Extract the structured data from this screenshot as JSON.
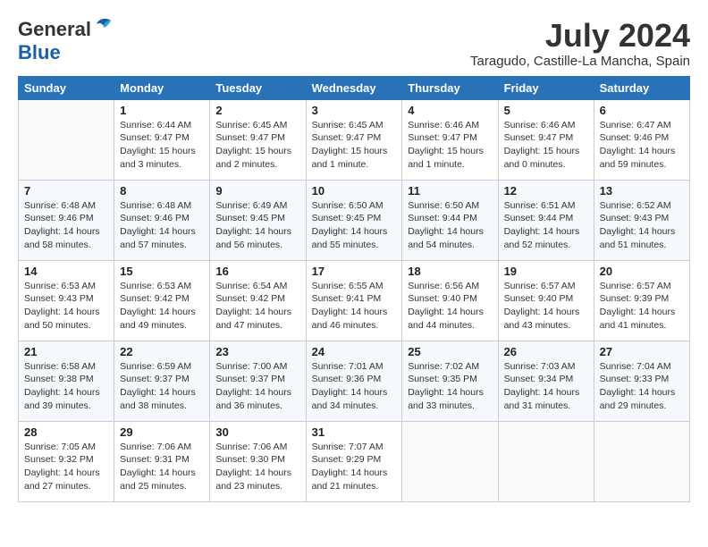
{
  "header": {
    "logo_general": "General",
    "logo_blue": "Blue",
    "month_year": "July 2024",
    "location": "Taragudo, Castille-La Mancha, Spain"
  },
  "weekdays": [
    "Sunday",
    "Monday",
    "Tuesday",
    "Wednesday",
    "Thursday",
    "Friday",
    "Saturday"
  ],
  "weeks": [
    [
      {
        "day": "",
        "info": ""
      },
      {
        "day": "1",
        "info": "Sunrise: 6:44 AM\nSunset: 9:47 PM\nDaylight: 15 hours\nand 3 minutes."
      },
      {
        "day": "2",
        "info": "Sunrise: 6:45 AM\nSunset: 9:47 PM\nDaylight: 15 hours\nand 2 minutes."
      },
      {
        "day": "3",
        "info": "Sunrise: 6:45 AM\nSunset: 9:47 PM\nDaylight: 15 hours\nand 1 minute."
      },
      {
        "day": "4",
        "info": "Sunrise: 6:46 AM\nSunset: 9:47 PM\nDaylight: 15 hours\nand 1 minute."
      },
      {
        "day": "5",
        "info": "Sunrise: 6:46 AM\nSunset: 9:47 PM\nDaylight: 15 hours\nand 0 minutes."
      },
      {
        "day": "6",
        "info": "Sunrise: 6:47 AM\nSunset: 9:46 PM\nDaylight: 14 hours\nand 59 minutes."
      }
    ],
    [
      {
        "day": "7",
        "info": "Sunrise: 6:48 AM\nSunset: 9:46 PM\nDaylight: 14 hours\nand 58 minutes."
      },
      {
        "day": "8",
        "info": "Sunrise: 6:48 AM\nSunset: 9:46 PM\nDaylight: 14 hours\nand 57 minutes."
      },
      {
        "day": "9",
        "info": "Sunrise: 6:49 AM\nSunset: 9:45 PM\nDaylight: 14 hours\nand 56 minutes."
      },
      {
        "day": "10",
        "info": "Sunrise: 6:50 AM\nSunset: 9:45 PM\nDaylight: 14 hours\nand 55 minutes."
      },
      {
        "day": "11",
        "info": "Sunrise: 6:50 AM\nSunset: 9:44 PM\nDaylight: 14 hours\nand 54 minutes."
      },
      {
        "day": "12",
        "info": "Sunrise: 6:51 AM\nSunset: 9:44 PM\nDaylight: 14 hours\nand 52 minutes."
      },
      {
        "day": "13",
        "info": "Sunrise: 6:52 AM\nSunset: 9:43 PM\nDaylight: 14 hours\nand 51 minutes."
      }
    ],
    [
      {
        "day": "14",
        "info": "Sunrise: 6:53 AM\nSunset: 9:43 PM\nDaylight: 14 hours\nand 50 minutes."
      },
      {
        "day": "15",
        "info": "Sunrise: 6:53 AM\nSunset: 9:42 PM\nDaylight: 14 hours\nand 49 minutes."
      },
      {
        "day": "16",
        "info": "Sunrise: 6:54 AM\nSunset: 9:42 PM\nDaylight: 14 hours\nand 47 minutes."
      },
      {
        "day": "17",
        "info": "Sunrise: 6:55 AM\nSunset: 9:41 PM\nDaylight: 14 hours\nand 46 minutes."
      },
      {
        "day": "18",
        "info": "Sunrise: 6:56 AM\nSunset: 9:40 PM\nDaylight: 14 hours\nand 44 minutes."
      },
      {
        "day": "19",
        "info": "Sunrise: 6:57 AM\nSunset: 9:40 PM\nDaylight: 14 hours\nand 43 minutes."
      },
      {
        "day": "20",
        "info": "Sunrise: 6:57 AM\nSunset: 9:39 PM\nDaylight: 14 hours\nand 41 minutes."
      }
    ],
    [
      {
        "day": "21",
        "info": "Sunrise: 6:58 AM\nSunset: 9:38 PM\nDaylight: 14 hours\nand 39 minutes."
      },
      {
        "day": "22",
        "info": "Sunrise: 6:59 AM\nSunset: 9:37 PM\nDaylight: 14 hours\nand 38 minutes."
      },
      {
        "day": "23",
        "info": "Sunrise: 7:00 AM\nSunset: 9:37 PM\nDaylight: 14 hours\nand 36 minutes."
      },
      {
        "day": "24",
        "info": "Sunrise: 7:01 AM\nSunset: 9:36 PM\nDaylight: 14 hours\nand 34 minutes."
      },
      {
        "day": "25",
        "info": "Sunrise: 7:02 AM\nSunset: 9:35 PM\nDaylight: 14 hours\nand 33 minutes."
      },
      {
        "day": "26",
        "info": "Sunrise: 7:03 AM\nSunset: 9:34 PM\nDaylight: 14 hours\nand 31 minutes."
      },
      {
        "day": "27",
        "info": "Sunrise: 7:04 AM\nSunset: 9:33 PM\nDaylight: 14 hours\nand 29 minutes."
      }
    ],
    [
      {
        "day": "28",
        "info": "Sunrise: 7:05 AM\nSunset: 9:32 PM\nDaylight: 14 hours\nand 27 minutes."
      },
      {
        "day": "29",
        "info": "Sunrise: 7:06 AM\nSunset: 9:31 PM\nDaylight: 14 hours\nand 25 minutes."
      },
      {
        "day": "30",
        "info": "Sunrise: 7:06 AM\nSunset: 9:30 PM\nDaylight: 14 hours\nand 23 minutes."
      },
      {
        "day": "31",
        "info": "Sunrise: 7:07 AM\nSunset: 9:29 PM\nDaylight: 14 hours\nand 21 minutes."
      },
      {
        "day": "",
        "info": ""
      },
      {
        "day": "",
        "info": ""
      },
      {
        "day": "",
        "info": ""
      }
    ]
  ]
}
